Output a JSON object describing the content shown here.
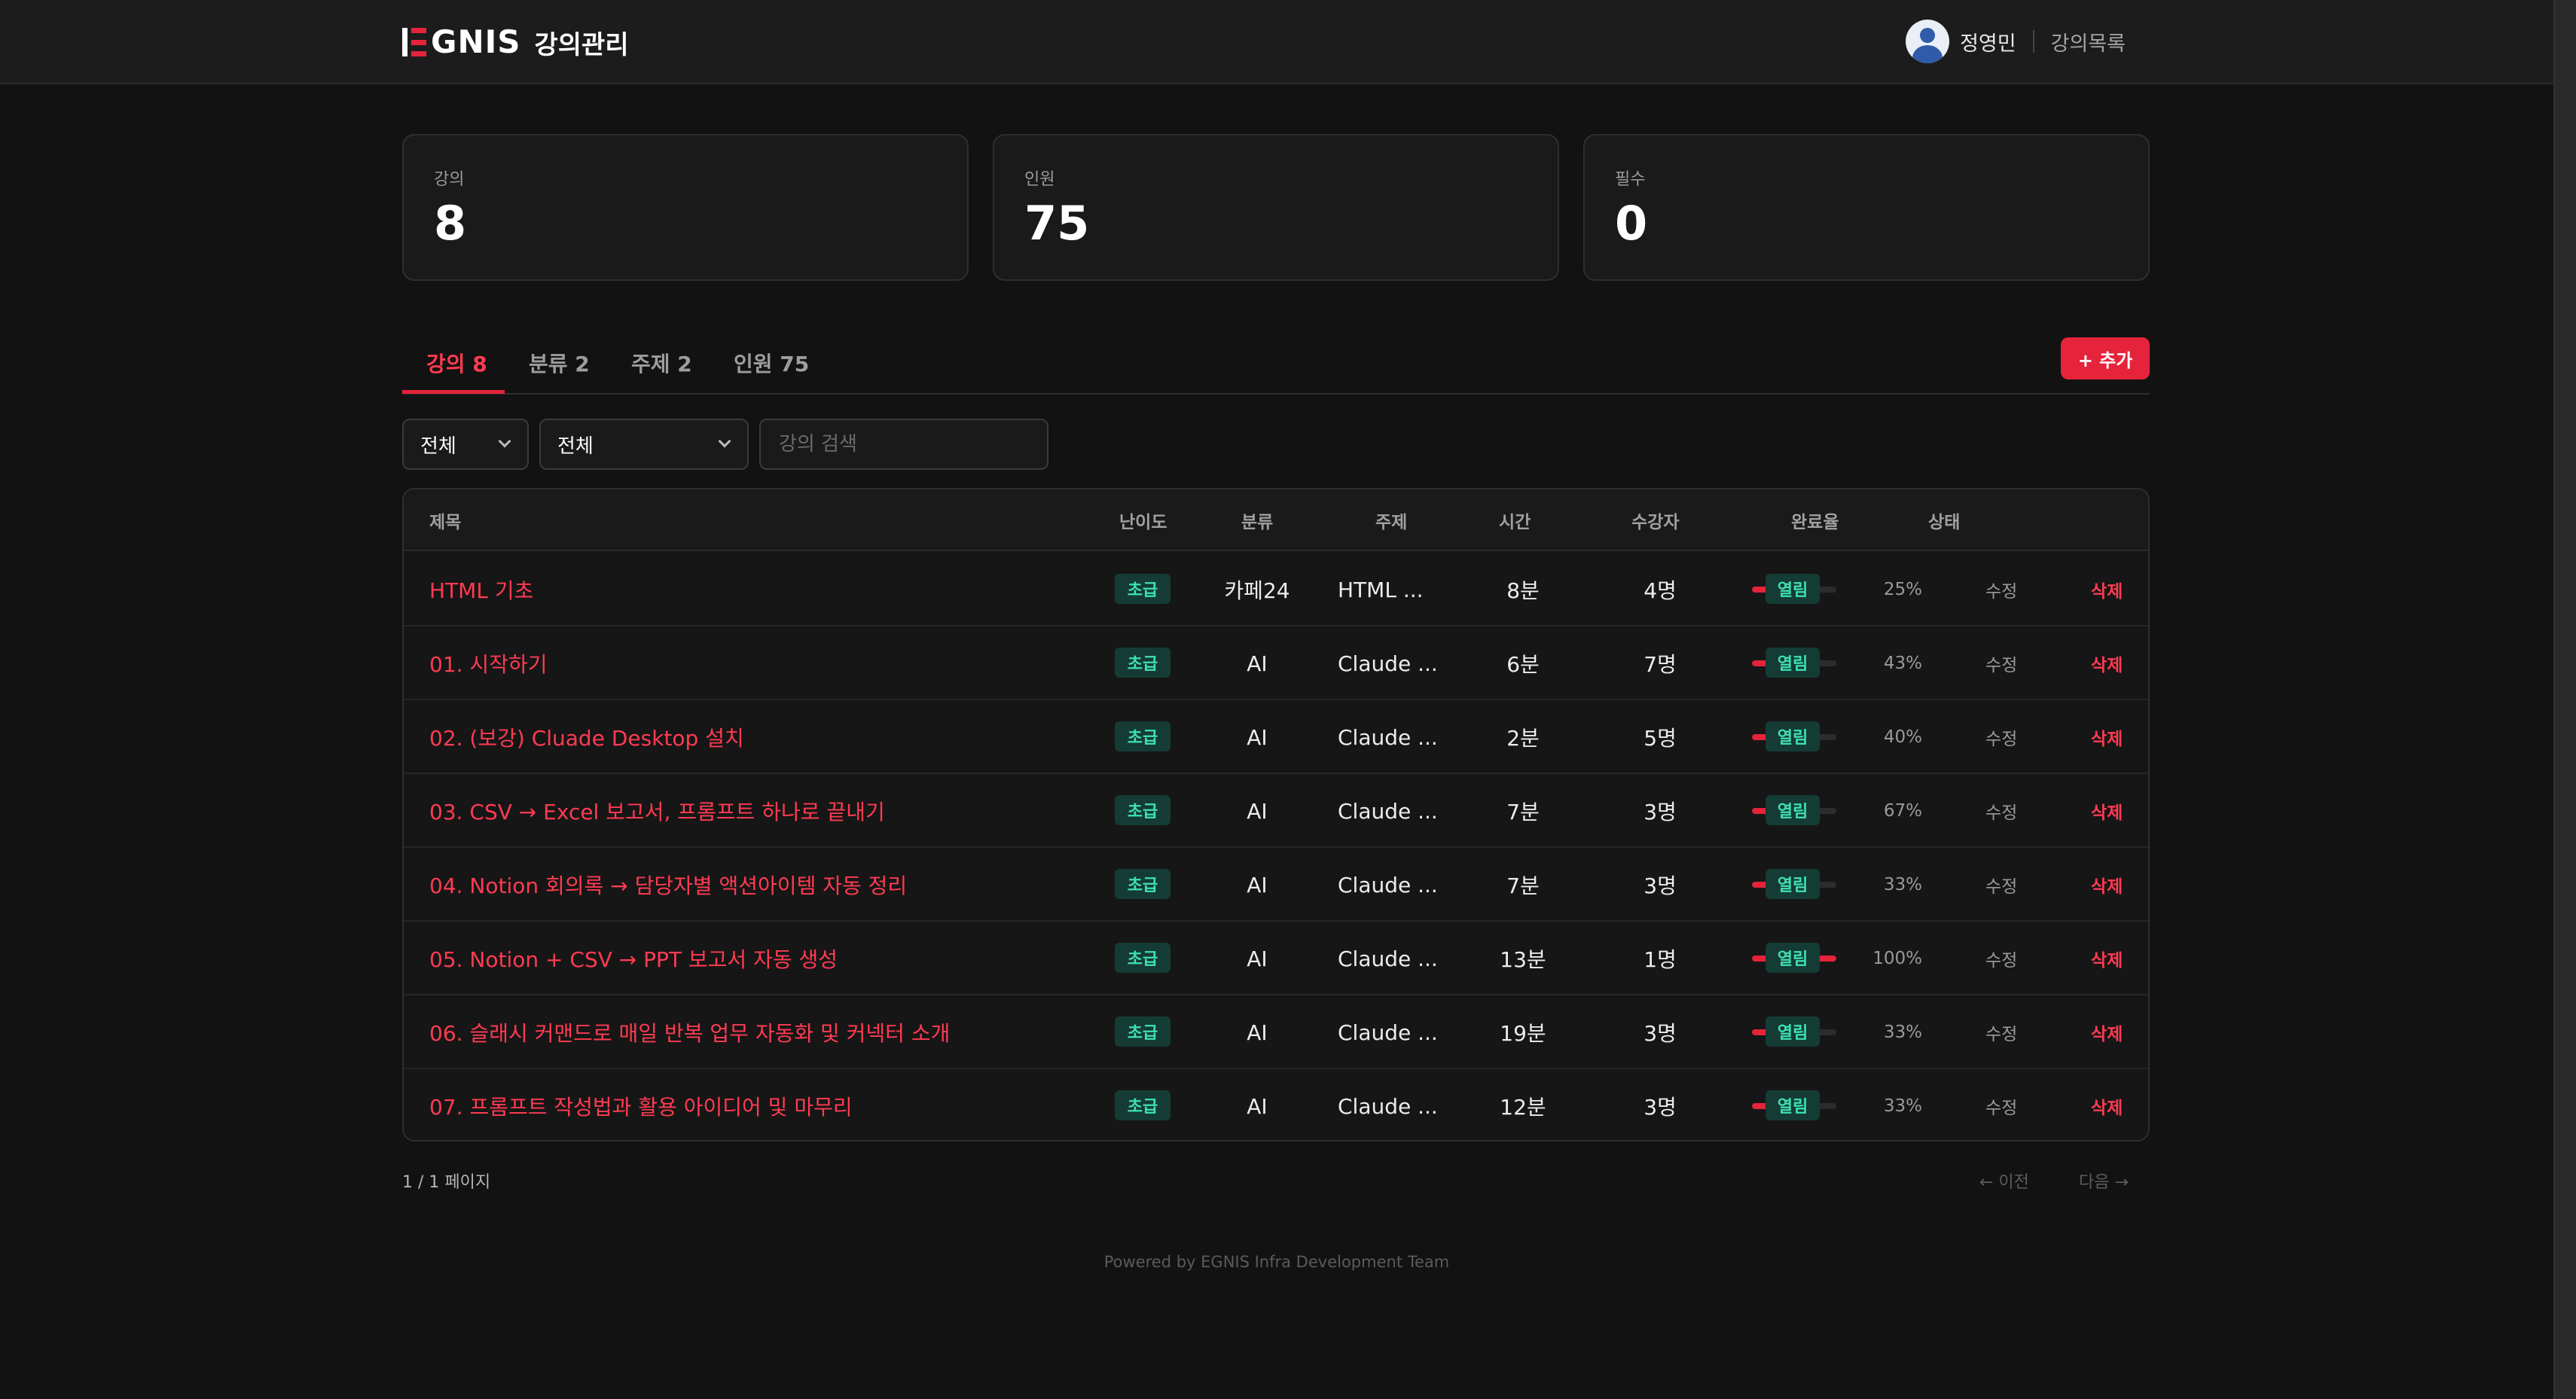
{
  "header": {
    "logo_text": "GNIS",
    "app_name": "강의관리",
    "user_name": "정영민",
    "nav_link": "강의목록"
  },
  "stats": [
    {
      "label": "강의",
      "value": "8"
    },
    {
      "label": "인원",
      "value": "75"
    },
    {
      "label": "필수",
      "value": "0"
    }
  ],
  "tabs": [
    {
      "label": "강의 8",
      "active": true
    },
    {
      "label": "분류 2",
      "active": false
    },
    {
      "label": "주제 2",
      "active": false
    },
    {
      "label": "인원 75",
      "active": false
    }
  ],
  "add_button": "+ 추가",
  "filters": {
    "category": "전체",
    "topic": "전체",
    "search_placeholder": "강의 검색"
  },
  "table": {
    "columns": [
      "제목",
      "난이도",
      "분류",
      "주제",
      "시간",
      "수강자",
      "완료율",
      "상태"
    ],
    "edit_label": "수정",
    "delete_label": "삭제",
    "rows": [
      {
        "title": "HTML 기초",
        "level": "초급",
        "category": "카페24",
        "topic": "HTML ...",
        "time": "8분",
        "students": "4명",
        "progress": 25,
        "pct": "25%",
        "status": "열림"
      },
      {
        "title": "01. 시작하기",
        "level": "초급",
        "category": "AI",
        "topic": "Claude ...",
        "time": "6분",
        "students": "7명",
        "progress": 43,
        "pct": "43%",
        "status": "열림"
      },
      {
        "title": "02. (보강) Cluade Desktop 설치",
        "level": "초급",
        "category": "AI",
        "topic": "Claude ...",
        "time": "2분",
        "students": "5명",
        "progress": 40,
        "pct": "40%",
        "status": "열림"
      },
      {
        "title": "03. CSV → Excel 보고서, 프롬프트 하나로 끝내기",
        "level": "초급",
        "category": "AI",
        "topic": "Claude ...",
        "time": "7분",
        "students": "3명",
        "progress": 67,
        "pct": "67%",
        "status": "열림"
      },
      {
        "title": "04. Notion 회의록 → 담당자별 액션아이템 자동 정리",
        "level": "초급",
        "category": "AI",
        "topic": "Claude ...",
        "time": "7분",
        "students": "3명",
        "progress": 33,
        "pct": "33%",
        "status": "열림"
      },
      {
        "title": "05. Notion + CSV → PPT 보고서 자동 생성",
        "level": "초급",
        "category": "AI",
        "topic": "Claude ...",
        "time": "13분",
        "students": "1명",
        "progress": 100,
        "pct": "100%",
        "status": "열림"
      },
      {
        "title": "06. 슬래시 커맨드로 매일 반복 업무 자동화 및 커넥터 소개",
        "level": "초급",
        "category": "AI",
        "topic": "Claude ...",
        "time": "19분",
        "students": "3명",
        "progress": 33,
        "pct": "33%",
        "status": "열림"
      },
      {
        "title": "07. 프롬프트 작성법과 활용 아이디어 및 마무리",
        "level": "초급",
        "category": "AI",
        "topic": "Claude ...",
        "time": "12분",
        "students": "3명",
        "progress": 33,
        "pct": "33%",
        "status": "열림"
      }
    ]
  },
  "pagination": {
    "info": "1 / 1 페이지",
    "prev": "← 이전",
    "next": "다음 →"
  },
  "footer": "Powered by EGNIS Infra Development Team",
  "colors": {
    "accent": "#e5233b",
    "badge_bg": "#143c34",
    "badge_text": "#3fe0b1"
  }
}
